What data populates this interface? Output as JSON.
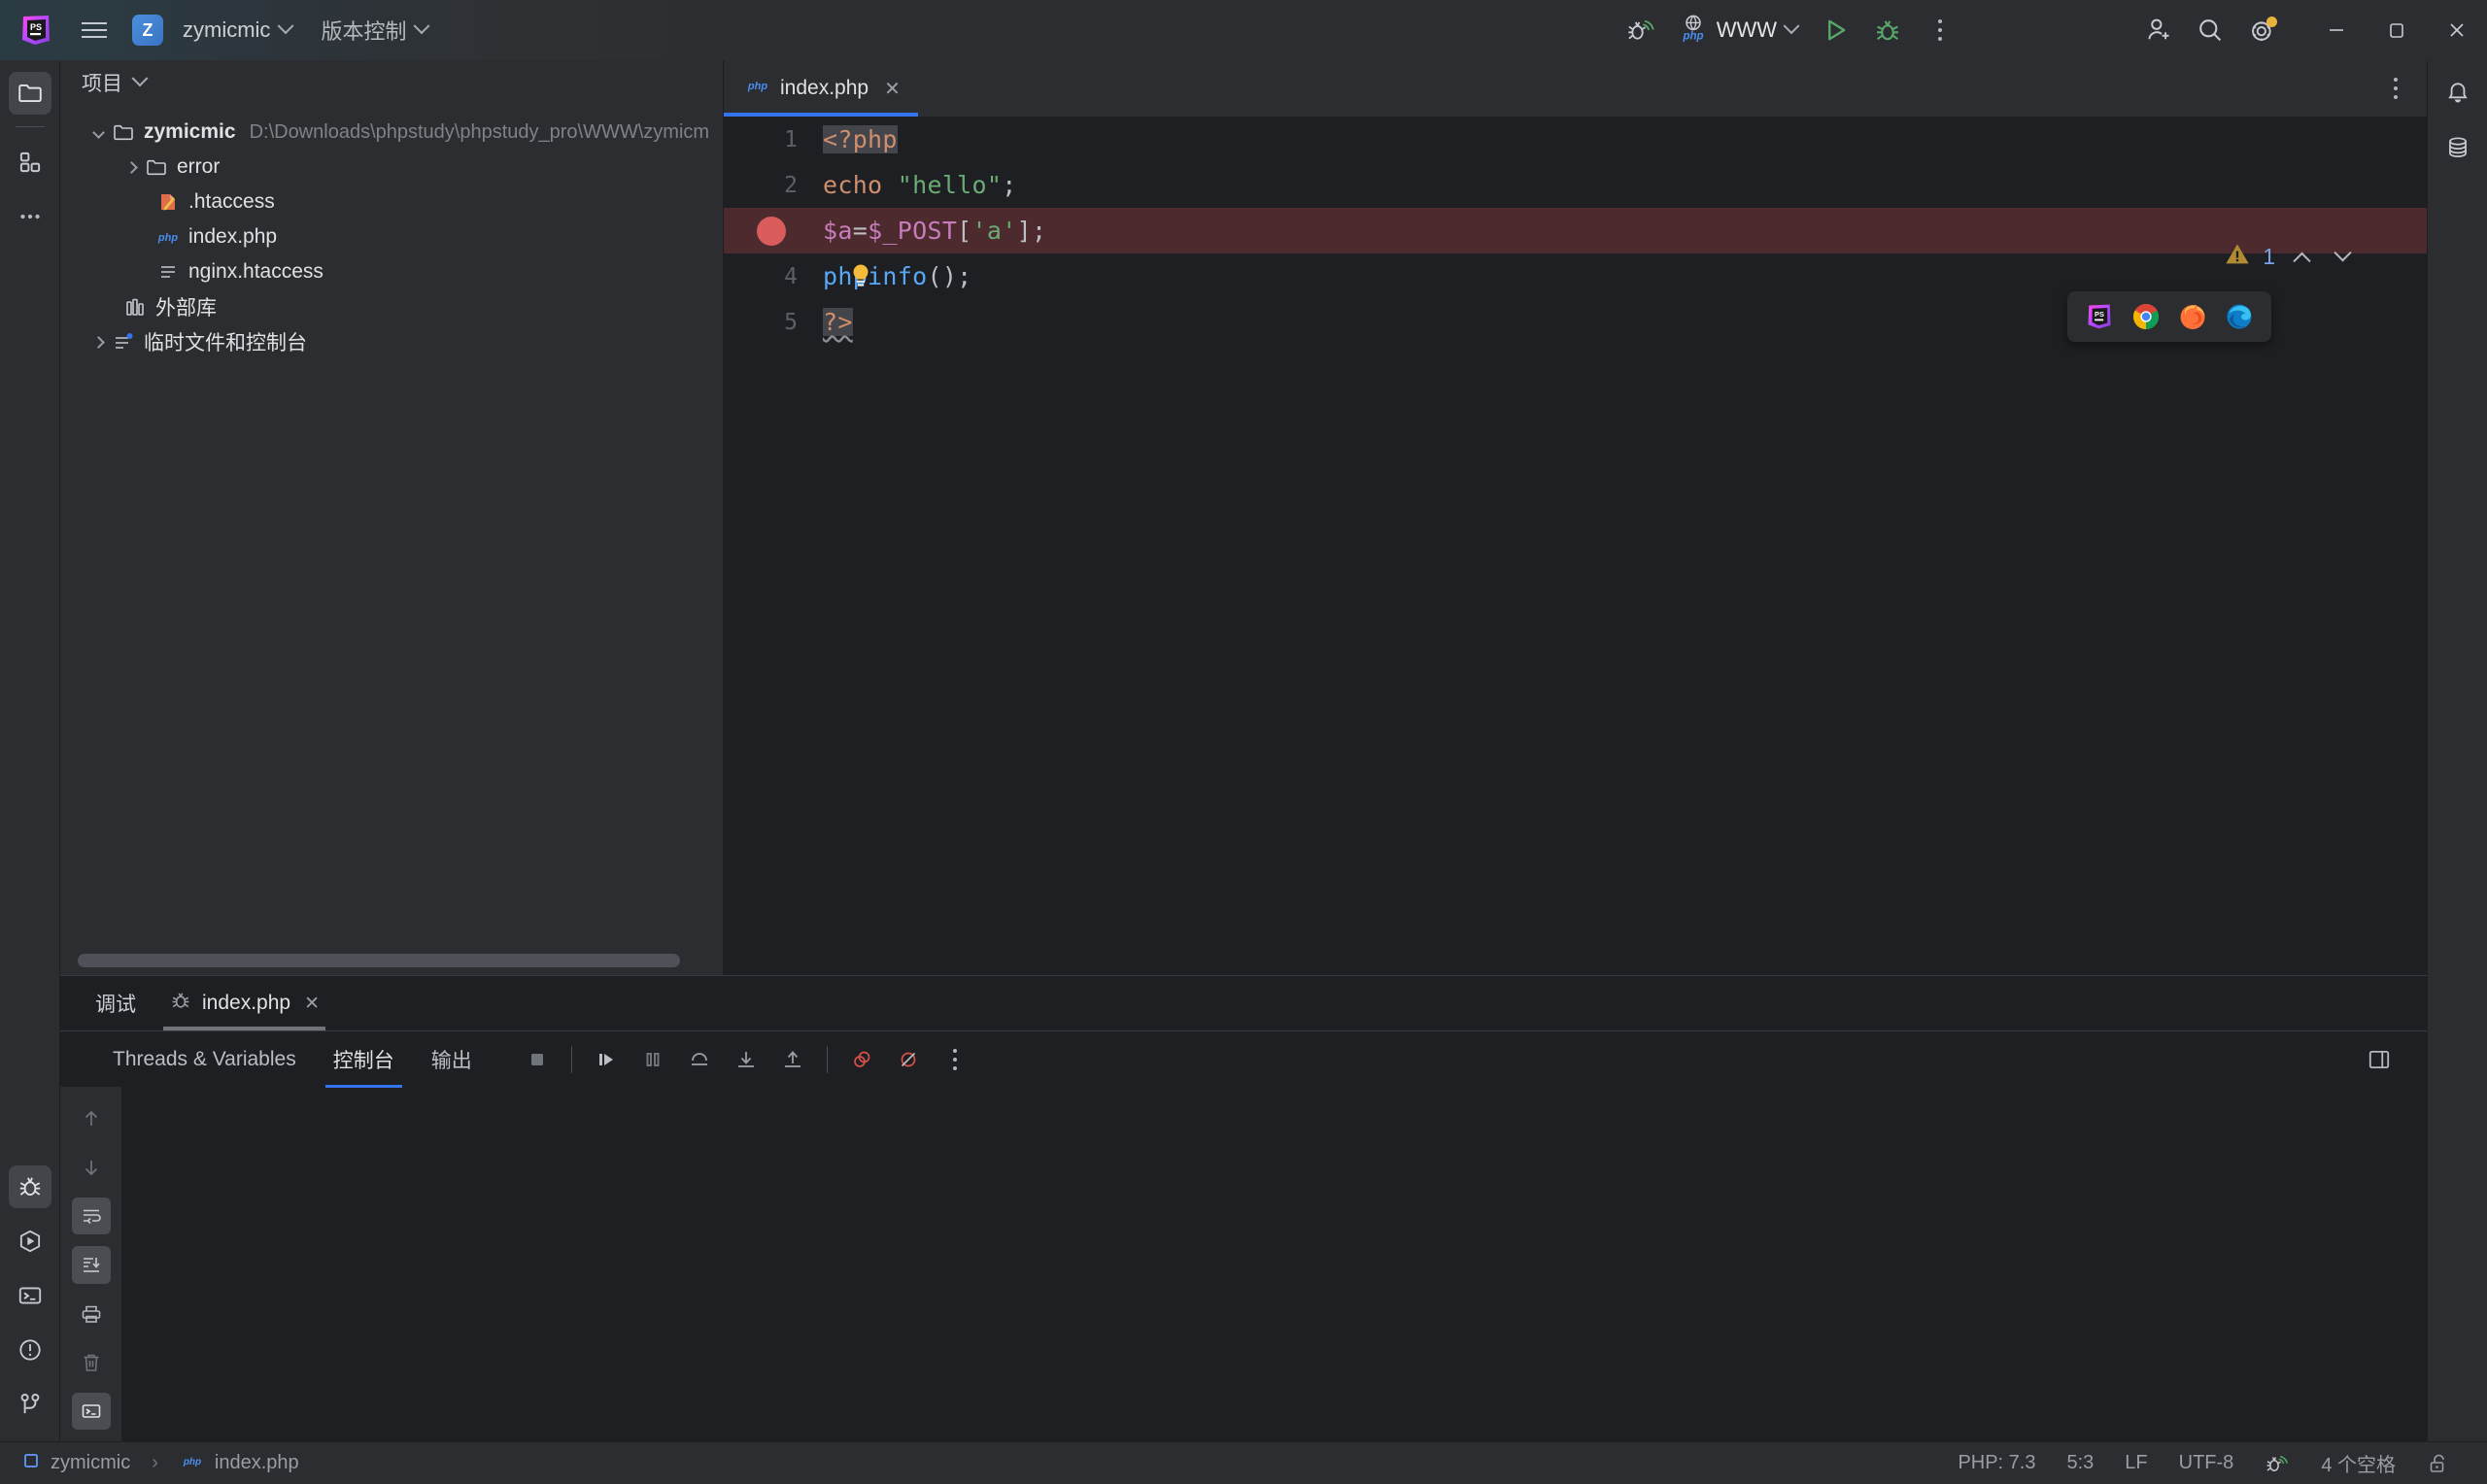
{
  "titlebar": {
    "logo_icon": "phpstorm-logo-icon",
    "menu_icon": "hamburger-menu-icon",
    "project_badge": "Z",
    "project_name": "zymicmic",
    "vcs_label": "版本控制",
    "debug_listen_icon": "debug-listen-icon",
    "run_config": {
      "icon": "php-web-icon",
      "label": "WWW",
      "chevron_icon": "chevron-down-icon"
    },
    "run_icon": "run-play-icon",
    "debug_icon": "debug-bug-icon",
    "more_icon": "more-vertical-icon",
    "user_add_icon": "user-add-icon",
    "search_icon": "search-icon",
    "settings_icon": "gear-icon",
    "minimize_icon": "minimize-icon",
    "maximize_icon": "maximize-icon",
    "close_icon": "close-icon"
  },
  "left_rail": {
    "top": [
      {
        "name": "project-tool-window",
        "icon": "folder-icon",
        "active": true
      },
      {
        "name": "structure-tool-window",
        "icon": "plugins-squares-icon",
        "active": false
      },
      {
        "name": "more-tool-windows",
        "icon": "more-horizontal-icon",
        "active": false
      }
    ],
    "bottom": [
      {
        "name": "debug-tool-window",
        "icon": "bug-icon",
        "active": true
      },
      {
        "name": "run-tool-window",
        "icon": "run-hexagon-icon",
        "active": false
      },
      {
        "name": "terminal-tool-window",
        "icon": "terminal-icon",
        "active": false
      },
      {
        "name": "problems-tool-window",
        "icon": "warning-circle-icon",
        "active": false
      },
      {
        "name": "version-control-tool-window",
        "icon": "git-branch-icon",
        "active": false
      }
    ]
  },
  "project_panel": {
    "title": "项目",
    "chevron_icon": "chevron-down-icon",
    "tree": [
      {
        "name": "zymicmic",
        "path": "D:\\Downloads\\phpstudy\\phpstudy_pro\\WWW\\zymicm",
        "icon": "folder-icon",
        "arrow": "open",
        "depth": 0,
        "bold": true
      },
      {
        "name": "error",
        "path": "",
        "icon": "folder-icon",
        "arrow": "closed",
        "depth": 1,
        "bold": false
      },
      {
        "name": ".htaccess",
        "path": "",
        "icon": "htaccess-icon",
        "arrow": "none",
        "depth": 2,
        "bold": false
      },
      {
        "name": "index.php",
        "path": "",
        "icon": "php-file-icon",
        "arrow": "none",
        "depth": 2,
        "bold": false
      },
      {
        "name": "nginx.htaccess",
        "path": "",
        "icon": "text-file-icon",
        "arrow": "none",
        "depth": 2,
        "bold": false
      },
      {
        "name": "外部库",
        "path": "",
        "icon": "library-icon",
        "arrow": "none",
        "depth": 1,
        "bold": false
      },
      {
        "name": "临时文件和控制台",
        "path": "",
        "icon": "scratches-icon",
        "arrow": "closed",
        "depth": 0,
        "bold": false
      }
    ]
  },
  "editor": {
    "tab": {
      "label": "index.php",
      "icon": "php-file-icon",
      "close_icon": "close-icon",
      "active": true
    },
    "options_icon": "more-vertical-icon",
    "inspection": {
      "warning_icon": "warning-triangle-icon",
      "count": "1",
      "prev_icon": "chevron-up-icon",
      "next_icon": "chevron-down-icon"
    },
    "browser_popup": [
      {
        "name": "open-in-phpstorm-builtin",
        "icon": "phpstorm-icon"
      },
      {
        "name": "open-in-chrome",
        "icon": "chrome-icon"
      },
      {
        "name": "open-in-firefox",
        "icon": "firefox-icon"
      },
      {
        "name": "open-in-edge",
        "icon": "edge-icon"
      }
    ],
    "lines": [
      {
        "num": "1",
        "breakpoint": false,
        "selected": true,
        "tokens": [
          {
            "t": "<?php",
            "c": "k-tag"
          }
        ]
      },
      {
        "num": "2",
        "breakpoint": false,
        "selected": false,
        "tokens": [
          {
            "t": "echo ",
            "c": "k-kw"
          },
          {
            "t": "\"hello\"",
            "c": "k-str"
          },
          {
            "t": ";",
            "c": "k-pl"
          }
        ]
      },
      {
        "num": "3",
        "breakpoint": true,
        "selected": false,
        "tokens": [
          {
            "t": "$a",
            "c": "k-var"
          },
          {
            "t": "=",
            "c": "k-pl"
          },
          {
            "t": "$_POST",
            "c": "k-var"
          },
          {
            "t": "[",
            "c": "k-pl"
          },
          {
            "t": "'a'",
            "c": "k-str"
          },
          {
            "t": "]",
            "c": "k-pl"
          },
          {
            "t": ";",
            "c": "k-pl"
          }
        ]
      },
      {
        "num": "4",
        "breakpoint": false,
        "selected": false,
        "bulb": true,
        "tokens": [
          {
            "t": "phpinfo",
            "c": "k-fn"
          },
          {
            "t": "();",
            "c": "k-pl"
          }
        ]
      },
      {
        "num": "5",
        "breakpoint": false,
        "selected": true,
        "squiggle": true,
        "tokens": [
          {
            "t": "?>",
            "c": "k-tag"
          }
        ]
      }
    ]
  },
  "debug_panel": {
    "title": "调试",
    "tab": {
      "label": "index.php",
      "icon": "bug-icon",
      "close_icon": "close-icon"
    },
    "subtabs": [
      {
        "label": "Threads & Variables",
        "active": false
      },
      {
        "label": "控制台",
        "active": true
      },
      {
        "label": "输出",
        "active": false
      }
    ],
    "controls": [
      {
        "name": "stop-button",
        "icon": "stop-square-icon"
      },
      {
        "name": "resume-button",
        "icon": "resume-play-icon"
      },
      {
        "name": "pause-button",
        "icon": "pause-icon"
      },
      {
        "name": "step-over-button",
        "icon": "step-over-icon"
      },
      {
        "name": "step-into-button",
        "icon": "step-into-icon"
      },
      {
        "name": "step-out-button",
        "icon": "step-out-icon"
      },
      {
        "name": "view-breakpoints-button",
        "icon": "breakpoints-icon"
      },
      {
        "name": "mute-breakpoints-button",
        "icon": "mute-breakpoints-icon"
      },
      {
        "name": "debug-more-button",
        "icon": "more-vertical-icon"
      }
    ],
    "layout_icon": "layout-settings-icon",
    "side_buttons": [
      {
        "name": "scroll-up-button",
        "icon": "arrow-up-icon",
        "on": false
      },
      {
        "name": "scroll-down-button",
        "icon": "arrow-down-icon",
        "on": false
      },
      {
        "name": "soft-wrap-button",
        "icon": "soft-wrap-icon",
        "on": true
      },
      {
        "name": "scroll-to-end-button",
        "icon": "scroll-to-end-icon",
        "on": true
      },
      {
        "name": "print-button",
        "icon": "print-icon",
        "on": false
      },
      {
        "name": "clear-all-button",
        "icon": "trash-icon",
        "on": false
      },
      {
        "name": "open-console-button",
        "icon": "terminal-icon",
        "on": true
      }
    ],
    "console_output": ""
  },
  "right_rail": [
    {
      "name": "notifications-tool-window",
      "icon": "bell-icon"
    },
    {
      "name": "database-tool-window",
      "icon": "database-icon"
    }
  ],
  "statusbar": {
    "breadcrumb": [
      {
        "label": "zymicmic",
        "icon": "module-square-icon"
      },
      {
        "label": "index.php",
        "icon": "php-file-icon"
      }
    ],
    "separator": "›",
    "items": [
      {
        "name": "php-version",
        "label": "PHP: 7.3"
      },
      {
        "name": "caret-position",
        "label": "5:3"
      },
      {
        "name": "line-separator",
        "label": "LF"
      },
      {
        "name": "file-encoding",
        "label": "UTF-8"
      }
    ],
    "debug_listen_icon": "debug-listen-icon",
    "indent": "4 个空格",
    "lock_icon": "unlocked-icon"
  },
  "colors": {
    "accent": "#3574f0",
    "breakpoint": "#db5c5c",
    "breakpoint_line_bg": "#4c2a2d",
    "warning": "#c9a227",
    "run_green": "#59a869",
    "panel_bg": "#2b2d30",
    "editor_bg": "#1e1f22"
  }
}
